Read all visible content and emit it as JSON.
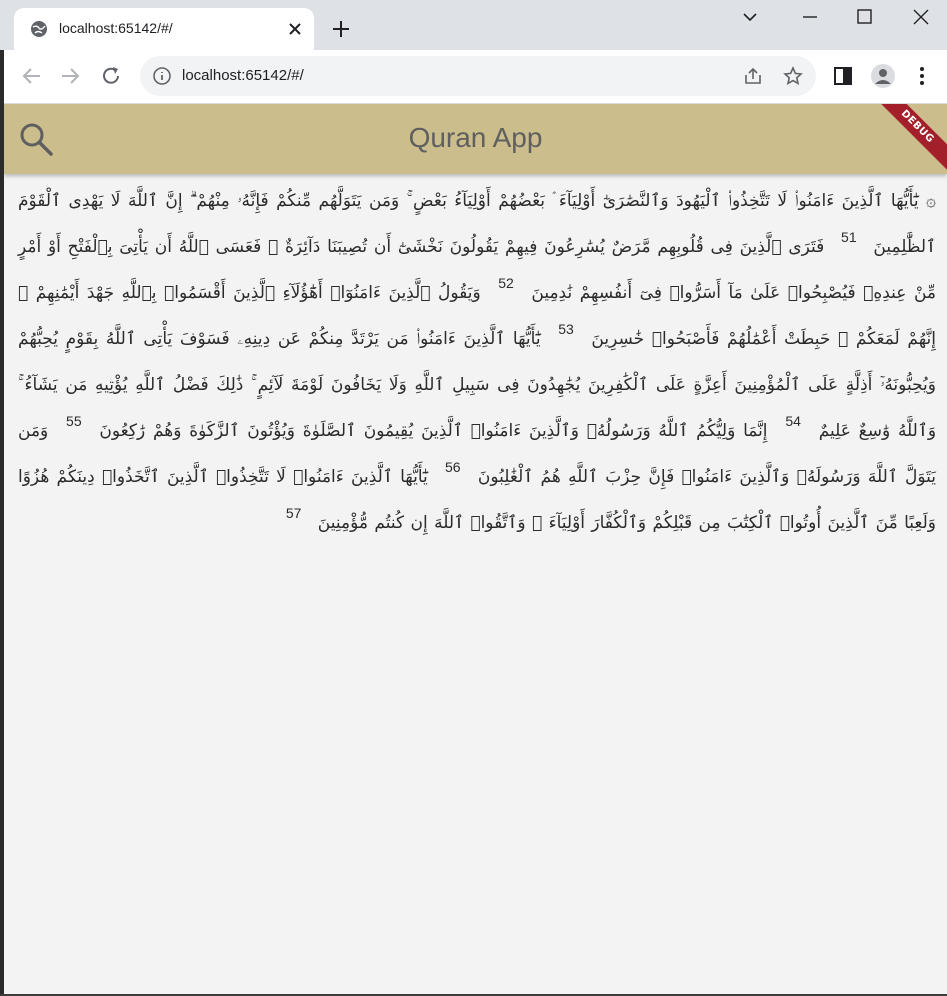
{
  "browser": {
    "tab_title": "localhost:65142/#/",
    "url": "localhost:65142/#/"
  },
  "app": {
    "title": "Quran App",
    "debug_label": "DEBUG"
  },
  "verses": [
    {
      "text": "۞ يَٰٓأَيُّهَا ٱلَّذِينَ ءَامَنُوا۟ لَا تَتَّخِذُوا۟ ٱلْيَهُودَ وَٱلنَّصَٰرَىٰٓ أَوْلِيَآءَ ۘ بَعْضُهُمْ أَوْلِيَآءُ بَعْضٍ ۚ وَمَن يَتَوَلَّهُم مِّنكُمْ فَإِنَّهُۥ مِنْهُمْ ۗ إِنَّ ٱللَّهَ لَا يَهْدِى ٱلْقَوْمَ ٱلظَّٰلِمِينَ",
      "number": "51"
    },
    {
      "text": "فَتَرَى ٱلَّذِينَ فِى قُلُوبِهِم مَّرَضٌ يُسَٰرِعُونَ فِيهِمْ يَقُولُونَ نَخْشَىٰٓ أَن تُصِيبَنَا دَآئِرَةٌ ۚ فَعَسَى ٱللَّهُ أَن يَأْتِىَ بِٱلْفَتْحِ أَوْ أَمْرٍ مِّنْ عِندِهِۦ فَيُصْبِحُوا۟ عَلَىٰ مَآ أَسَرُّوا۟ فِىٓ أَنفُسِهِمْ نَٰدِمِينَ",
      "number": "52"
    },
    {
      "text": "وَيَقُولُ ٱلَّذِينَ ءَامَنُوٓا۟ أَهَٰٓؤُلَآءِ ٱلَّذِينَ أَقْسَمُوا۟ بِٱللَّهِ جَهْدَ أَيْمَٰنِهِمْ ۙ إِنَّهُمْ لَمَعَكُمْ ۚ حَبِطَتْ أَعْمَٰلُهُمْ فَأَصْبَحُوا۟ خَٰسِرِينَ",
      "number": "53"
    },
    {
      "text": "يَٰٓأَيُّهَا ٱلَّذِينَ ءَامَنُوا۟ مَن يَرْتَدَّ مِنكُمْ عَن دِينِهِۦ فَسَوْفَ يَأْتِى ٱللَّهُ بِقَوْمٍ يُحِبُّهُمْ وَيُحِبُّونَهُۥٓ أَذِلَّةٍ عَلَى ٱلْمُؤْمِنِينَ أَعِزَّةٍ عَلَى ٱلْكَٰفِرِينَ يُجَٰهِدُونَ فِى سَبِيلِ ٱللَّهِ وَلَا يَخَافُونَ لَوْمَةَ لَآئِمٍ ۚ ذَٰلِكَ فَضْلُ ٱللَّهِ يُؤْتِيهِ مَن يَشَآءُ ۚ وَٱللَّهُ وَٰسِعٌ عَلِيمٌ",
      "number": "54"
    },
    {
      "text": "إِنَّمَا وَلِيُّكُمُ ٱللَّهُ وَرَسُولُهُۥ وَٱلَّذِينَ ءَامَنُوا۟ ٱلَّذِينَ يُقِيمُونَ ٱلصَّلَوٰةَ وَيُؤْتُونَ ٱلزَّكَوٰةَ وَهُمْ رَٰكِعُونَ",
      "number": "55"
    },
    {
      "text": "وَمَن يَتَوَلَّ ٱللَّهَ وَرَسُولَهُۥ وَٱلَّذِينَ ءَامَنُوا۟ فَإِنَّ حِزْبَ ٱللَّهِ هُمُ ٱلْغَٰلِبُونَ",
      "number": "56"
    },
    {
      "text": "يَٰٓأَيُّهَا ٱلَّذِينَ ءَامَنُوا۟ لَا تَتَّخِذُوا۟ ٱلَّذِينَ ٱتَّخَذُوا۟ دِينَكُمْ هُزُوًا وَلَعِبًا مِّنَ ٱلَّذِينَ أُوتُوا۟ ٱلْكِتَٰبَ مِن قَبْلِكُمْ وَٱلْكُفَّارَ أَوْلِيَآءَ ۚ وَٱتَّقُوا۟ ٱللَّهَ إِن كُنتُم مُّؤْمِنِينَ",
      "number": "57"
    }
  ],
  "colors": {
    "appbar": "#cbbd8c",
    "title": "#5f5f5f",
    "background": "#f3f3f3",
    "debug_banner": "#a3202a"
  }
}
